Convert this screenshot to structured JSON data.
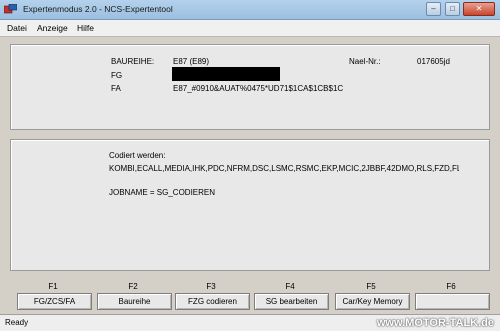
{
  "window": {
    "title": "Expertenmodus 2.0 - NCS-Expertentool"
  },
  "menu": {
    "items": [
      "Datei",
      "Anzeige",
      "Hilfe"
    ]
  },
  "vehicle_panel": {
    "baureihe_label": "BAUREIHE:",
    "baureihe_value": "E87 (E89)",
    "fg_label": "FG",
    "fa_label": "FA",
    "fa_value": "E87_#0910&AUAT%0475*UD71$1CA$1CB$1CC",
    "nael_label": "Nael-Nr.:",
    "nael_value": "017605jd"
  },
  "coding_panel": {
    "codiert_label": "Codiert werden:",
    "modules": "KOMBI,ECALL,MEDIA,IHK,PDC,NFRM,DSC,LSMC,RSMC,EKP,MCIC,2JBBF,42DMO,RLS,FZD,FL",
    "jobname": "JOBNAME = SG_CODIEREN"
  },
  "function_keys": [
    {
      "key": "F1",
      "label": "FG/ZCS/FA"
    },
    {
      "key": "F2",
      "label": "Baureihe"
    },
    {
      "key": "F3",
      "label": "FZG codieren"
    },
    {
      "key": "F4",
      "label": "SG bearbeiten"
    },
    {
      "key": "F5",
      "label": "Car/Key Memory"
    },
    {
      "key": "F6",
      "label": ""
    }
  ],
  "status": {
    "text": "Ready"
  },
  "watermark": "www.MOTOR-TALK.de"
}
